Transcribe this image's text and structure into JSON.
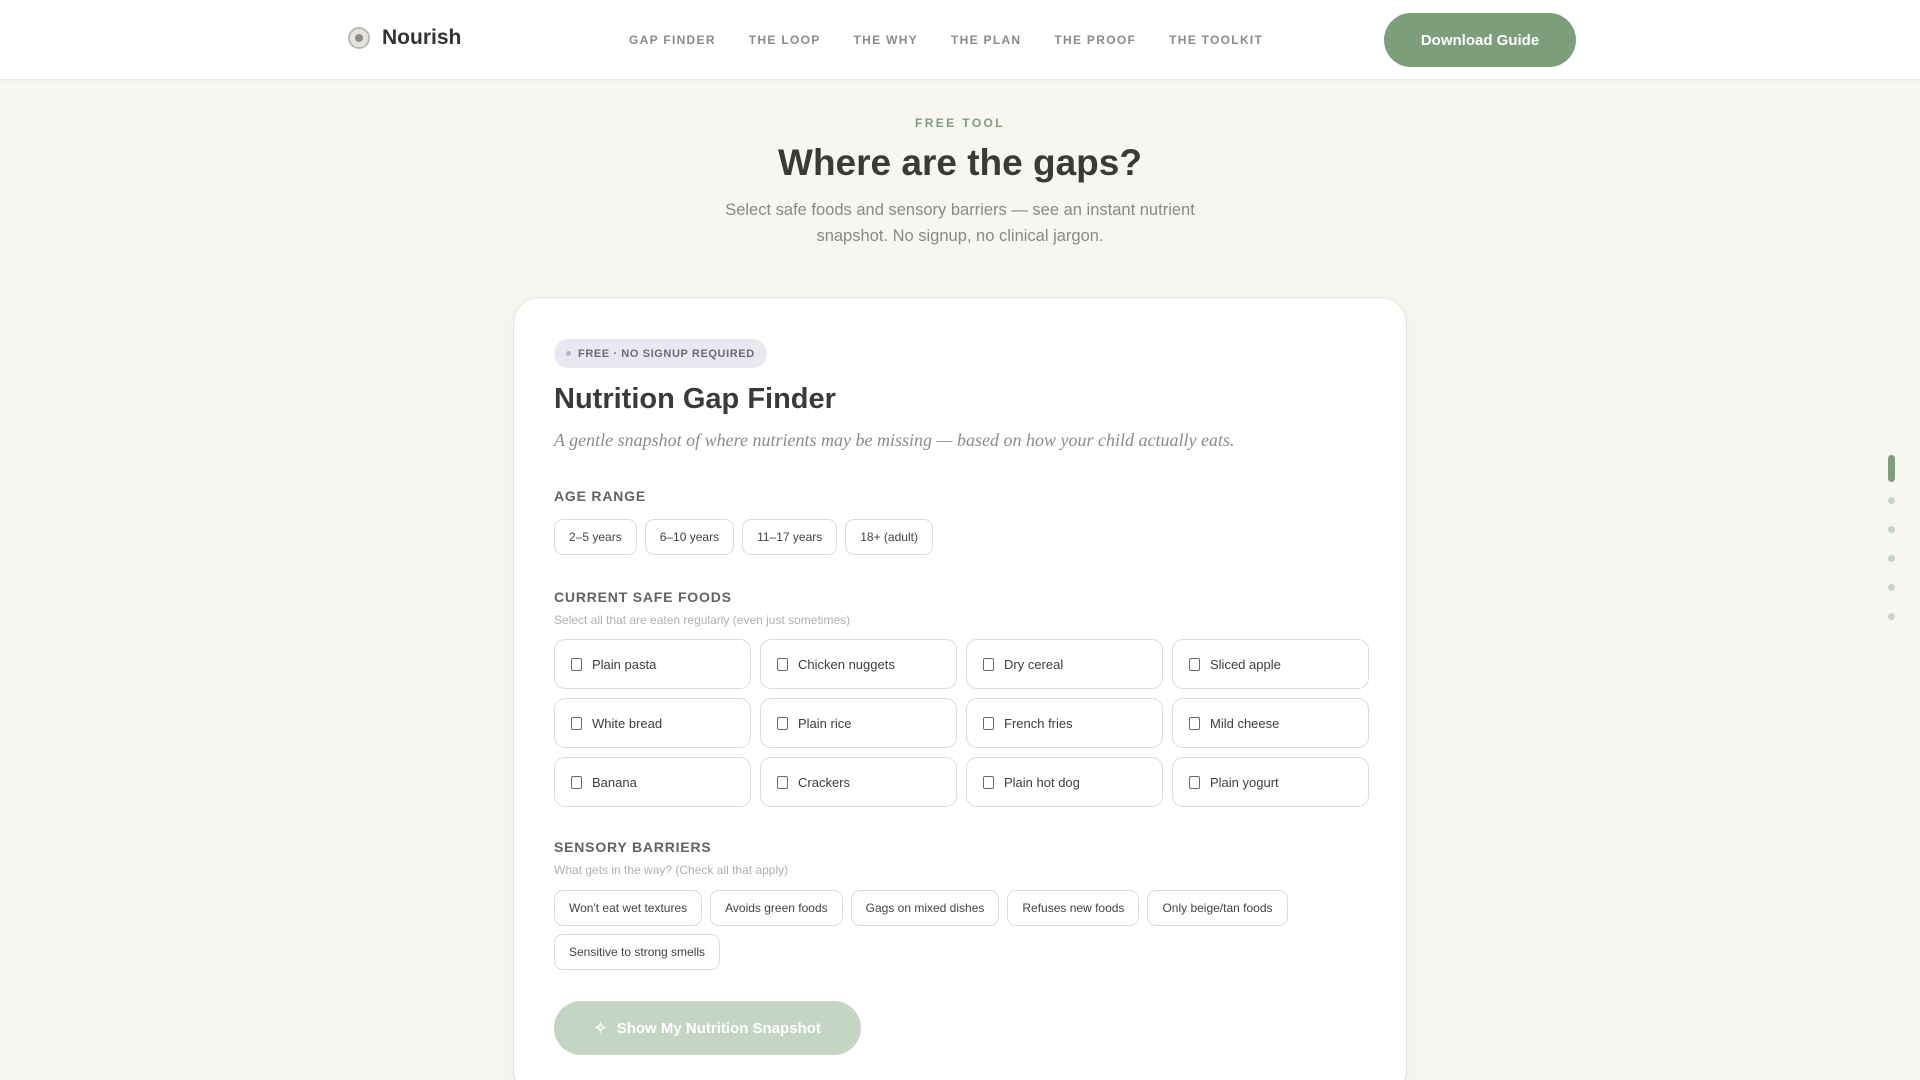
{
  "nav": {
    "brand": "Nourish",
    "links": [
      "GAP FINDER",
      "THE LOOP",
      "THE WHY",
      "THE PLAN",
      "THE PROOF",
      "THE TOOLKIT"
    ],
    "cta": "Download Guide"
  },
  "hero": {
    "eyebrow": "FREE TOOL",
    "title": "Where are the gaps?",
    "subtitle": "Select safe foods and sensory barriers — see an instant nutrient snapshot. No signup, no clinical jargon."
  },
  "card": {
    "badge": "FREE · NO SIGNUP REQUIRED",
    "title": "Nutrition Gap Finder",
    "subtitle": "A gentle snapshot of where nutrients may be missing — based on how your child actually eats.",
    "age": {
      "label": "AGE RANGE",
      "options": [
        "2–5 years",
        "6–10 years",
        "11–17 years",
        "18+ (adult)"
      ]
    },
    "foods": {
      "label": "CURRENT SAFE FOODS",
      "hint": "Select all that are eaten regularly (even just sometimes)",
      "items": [
        "Plain pasta",
        "Chicken nuggets",
        "Dry cereal",
        "Sliced apple",
        "White bread",
        "Plain rice",
        "French fries",
        "Mild cheese",
        "Banana",
        "Crackers",
        "Plain hot dog",
        "Plain yogurt"
      ]
    },
    "barriers": {
      "label": "SENSORY BARRIERS",
      "hint": "What gets in the way? (Check all that apply)",
      "items": [
        "Won't eat wet textures",
        "Avoids green foods",
        "Gags on mixed dishes",
        "Refuses new foods",
        "Only beige/tan foods",
        "Sensitive to strong smells"
      ]
    },
    "submit": "Show My Nutrition Snapshot"
  },
  "colors": {
    "accent": "#7d9e7b",
    "accent_disabled": "#c5d5c3",
    "background": "#f8f6f1",
    "badge_bg": "#ebe7f1"
  },
  "icons": {
    "logo": "logo-mark-icon",
    "submit": "sparkle-icon",
    "checkbox": "checkbox-icon"
  },
  "side_nav": {
    "active_index": 0,
    "count": 6
  }
}
